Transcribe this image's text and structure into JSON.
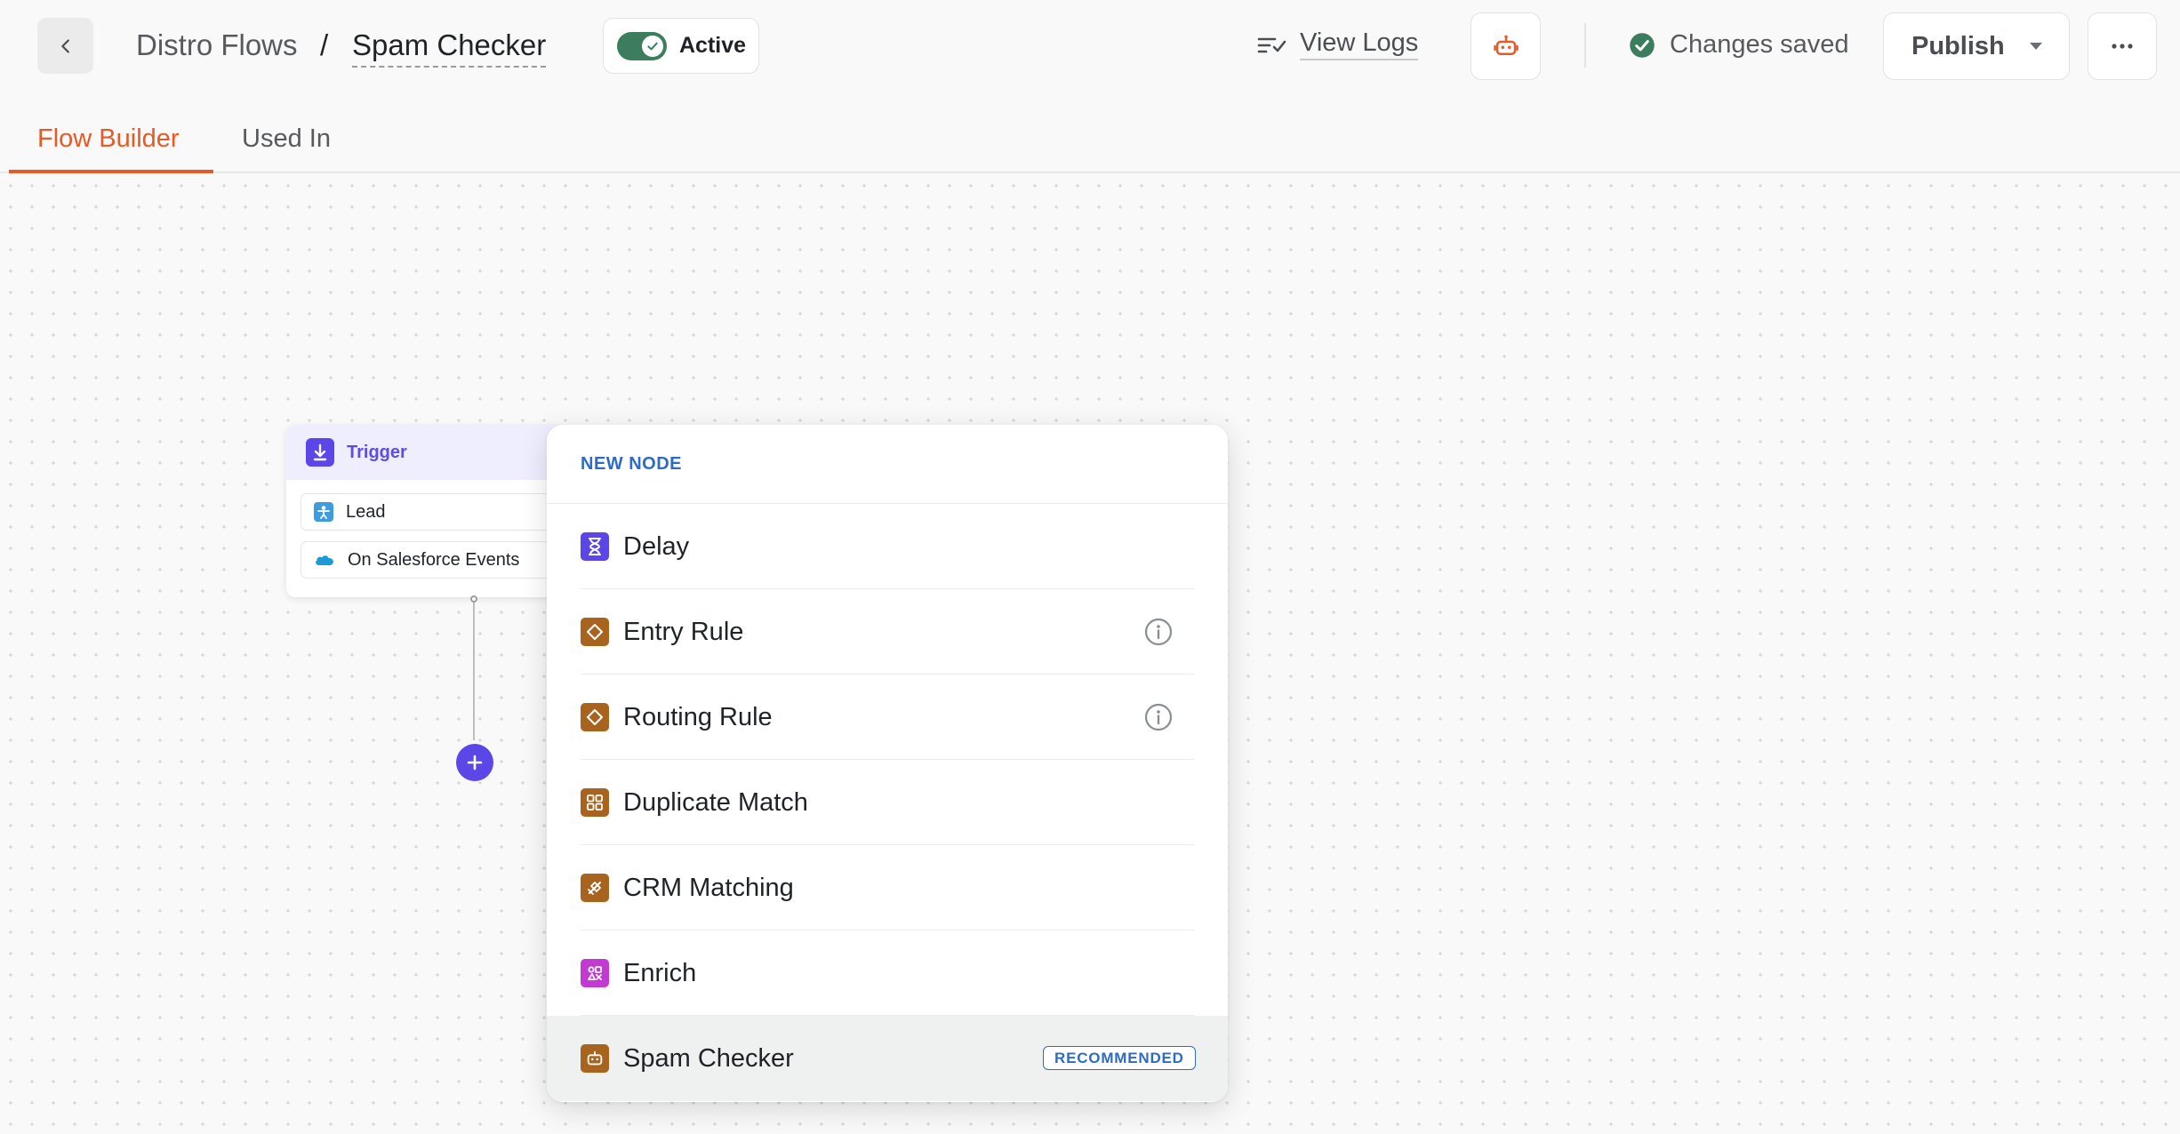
{
  "header": {
    "breadcrumb_parent": "Distro Flows",
    "breadcrumb_separator": "/",
    "breadcrumb_current": "Spam Checker",
    "status_toggle": {
      "label": "Active",
      "on": true
    },
    "view_logs_label": "View Logs",
    "save_status": "Changes saved",
    "publish_label": "Publish"
  },
  "tabs": [
    {
      "label": "Flow Builder",
      "active": true
    },
    {
      "label": "Used In",
      "active": false
    }
  ],
  "trigger": {
    "title": "Trigger",
    "rows": [
      {
        "label": "Lead",
        "icon": "lead-icon"
      },
      {
        "label": "On Salesforce Events",
        "icon": "salesforce-cloud-icon"
      }
    ]
  },
  "menu": {
    "title": "NEW NODE",
    "items": [
      {
        "label": "Delay",
        "icon": "hourglass-icon",
        "color": "#5b47e8"
      },
      {
        "label": "Entry Rule",
        "icon": "diamond-icon",
        "color": "#a8641f",
        "info": true
      },
      {
        "label": "Routing Rule",
        "icon": "diamond-icon",
        "color": "#a8641f",
        "info": true
      },
      {
        "label": "Duplicate Match",
        "icon": "grid-icon",
        "color": "#a8641f"
      },
      {
        "label": "CRM Matching",
        "icon": "crm-match-icon",
        "color": "#a8641f"
      },
      {
        "label": "Enrich",
        "icon": "enrich-icon",
        "color": "#c23ad1"
      },
      {
        "label": "Spam Checker",
        "icon": "robot-icon",
        "color": "#a8641f",
        "badge": "RECOMMENDED",
        "highlighted": true
      }
    ]
  },
  "colors": {
    "accent": "#e55a26",
    "toggle_on": "#3b7d5c",
    "primary": "#5b47e8",
    "link_blue": "#2e6cc4"
  }
}
